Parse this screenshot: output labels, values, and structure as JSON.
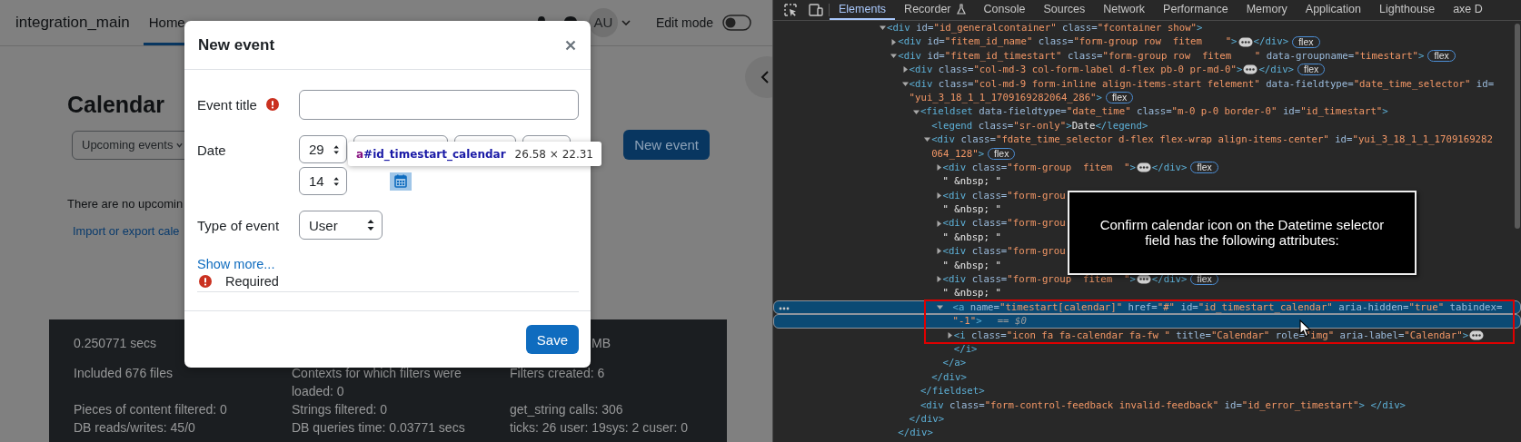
{
  "page": {
    "site_name": "integration_main",
    "nav": [
      {
        "label": "Home",
        "selected": true
      }
    ],
    "user_initials": "AU",
    "edit_mode": {
      "label": "Edit mode",
      "on": false
    },
    "heading": "Calendar",
    "view_select": {
      "value": "Upcoming events"
    },
    "new_event_button": "New event",
    "empty_message": "There are no upcomin",
    "import_link": "Import or export cale",
    "footer_rows": [
      [
        "0.250771 secs",
        null,
        "MB"
      ],
      [
        "Included 676 files",
        "Contexts for which filters were loaded: 0",
        "Filters created: 6"
      ],
      [
        "Pieces of content filtered: 0",
        "Strings filtered: 0",
        "get_string calls: 306"
      ],
      [
        "DB reads/writes: 45/0",
        "DB queries time: 0.03771 secs",
        "ticks: 26 user: 19sys: 2 cuser: 0"
      ]
    ]
  },
  "modal": {
    "title": "New event",
    "fields": [
      {
        "kind": "text",
        "label": "Event title",
        "required": true
      },
      {
        "kind": "date",
        "label": "Date",
        "required": false,
        "parts": [
          {
            "kind": "select",
            "value": "29"
          },
          {
            "kind": "covered"
          },
          {
            "kind": "covered"
          },
          {
            "kind": "covered"
          },
          {
            "kind": "select",
            "value": "14"
          },
          {
            "kind": "calendar",
            "highlighted": true
          }
        ]
      },
      {
        "kind": "select",
        "label": "Type of event",
        "required": false,
        "value": "User"
      }
    ],
    "show_more": "Show more...",
    "required_note": "Required",
    "save_button": "Save",
    "inspector_tooltip": {
      "selector": "a#id_timestart_calendar",
      "size": "26.58 × 22.31"
    }
  },
  "devtools": {
    "tabs": [
      {
        "label": "Elements",
        "selected": true
      },
      {
        "label": "Recorder",
        "selected": false,
        "experimental": true
      },
      {
        "label": "Console",
        "selected": false
      },
      {
        "label": "Sources",
        "selected": false
      },
      {
        "label": "Network",
        "selected": false
      },
      {
        "label": "Performance",
        "selected": false
      },
      {
        "label": "Memory",
        "selected": false
      },
      {
        "label": "Application",
        "selected": false
      },
      {
        "label": "Lighthouse",
        "selected": false
      },
      {
        "label": "axe D",
        "selected": false
      }
    ],
    "dom_tree": [
      {
        "kind": "element",
        "selected": false,
        "expanded": true,
        "lines": [
          "<div id=\"id_generalcontainer\" class=\"fcontainer show\">"
        ],
        "children": [
          {
            "kind": "element",
            "selected": false,
            "expanded": false,
            "lines": [
              "<div id=\"fitem_id_name\" class=\"form-group row  fitem    \">"
            ],
            "tail": "</div>",
            "badge": "flex"
          },
          {
            "kind": "element",
            "selected": false,
            "expanded": true,
            "lines": [
              "<div id=\"fitem_id_timestart\" class=\"form-group row  fitem    \" data-groupname=\"timestart\">"
            ],
            "badge": "flex",
            "close": "</div>",
            "children": [
              {
                "kind": "element",
                "selected": false,
                "expanded": false,
                "lines": [
                  "<div class=\"col-md-3 col-form-label d-flex pb-0 pr-md-0\">"
                ],
                "tail": "</div>",
                "badge": "flex"
              },
              {
                "kind": "element",
                "selected": false,
                "expanded": true,
                "lines": [
                  "<div class=\"col-md-9 form-inline align-items-start felement\" data-fieldtype=\"date_time_selector\" id=",
                  "\"yui_3_18_1_1_1709169282064_286\">"
                ],
                "badge": "flex",
                "close": "</div>",
                "children": [
                  {
                    "kind": "element",
                    "selected": false,
                    "expanded": true,
                    "lines": [
                      "<fieldset data-fieldtype=\"date_time\" class=\"m-0 p-0 border-0\" id=\"id_timestart\">"
                    ],
                    "close": "</fieldset>",
                    "children": [
                      {
                        "kind": "element",
                        "selected": false,
                        "lines": [
                          "<legend class=\"sr-only\">Date</legend>"
                        ]
                      },
                      {
                        "kind": "element",
                        "selected": false,
                        "expanded": true,
                        "lines": [
                          "<div class=\"fdate_time_selector d-flex flex-wrap align-items-center\" id=\"yui_3_18_1_1_1709169282",
                          "064_128\">"
                        ],
                        "badge": "flex",
                        "close": "</div>",
                        "children": [
                          {
                            "kind": "element",
                            "selected": false,
                            "expanded": false,
                            "lines": [
                              "<div class=\"form-group  fitem  \">"
                            ],
                            "tail": "</div>",
                            "badge": "flex"
                          },
                          {
                            "kind": "text",
                            "selected": false,
                            "lines": [
                              "\" &nbsp; \""
                            ]
                          },
                          {
                            "kind": "element",
                            "selected": false,
                            "expanded": false,
                            "lines": [
                              "<div class=\"form-grou"
                            ]
                          },
                          {
                            "kind": "text",
                            "selected": false,
                            "lines": [
                              "\" &nbsp; \""
                            ]
                          },
                          {
                            "kind": "element",
                            "selected": false,
                            "expanded": false,
                            "lines": [
                              "<div class=\"form-grou"
                            ]
                          },
                          {
                            "kind": "text",
                            "selected": false,
                            "lines": [
                              "\" &nbsp; \""
                            ]
                          },
                          {
                            "kind": "element",
                            "selected": false,
                            "expanded": false,
                            "lines": [
                              "<div class=\"form-grou"
                            ]
                          },
                          {
                            "kind": "text",
                            "selected": false,
                            "lines": [
                              "\" &nbsp; \""
                            ]
                          },
                          {
                            "kind": "element",
                            "selected": false,
                            "expanded": false,
                            "lines": [
                              "<div class=\"form-group  fitem  \">"
                            ],
                            "tail": "</div>",
                            "badge": "flex"
                          },
                          {
                            "kind": "text",
                            "selected": false,
                            "lines": [
                              "\" &nbsp; \""
                            ]
                          },
                          {
                            "kind": "element",
                            "selected": true,
                            "expanded": true,
                            "lines": [
                              "<a name=\"timestart[calendar]\" href=\"#\" id=\"id_timestart_calendar\" aria-hidden=\"true\" tabindex=",
                              "\"-1\">"
                            ],
                            "console_ref": "== $0",
                            "close": "</a>",
                            "children": [
                              {
                                "kind": "element",
                                "selected": false,
                                "expanded": false,
                                "lines": [
                                  "<i class=\"icon fa fa-calendar fa-fw \" title=\"Calendar\" role=\"img\" aria-label=\"Calendar\">"
                                ],
                                "tail": "</i>",
                                "tail_wrapped": true
                              }
                            ]
                          }
                        ]
                      }
                    ]
                  },
                  {
                    "kind": "element",
                    "selected": false,
                    "lines": [
                      "<div class=\"form-control-feedback invalid-feedback\" id=\"id_error_timestart\"> </div>"
                    ]
                  }
                ]
              }
            ]
          }
        ]
      }
    ],
    "callout": "Confirm calendar icon on the Datetime selector field has the following attributes:"
  }
}
